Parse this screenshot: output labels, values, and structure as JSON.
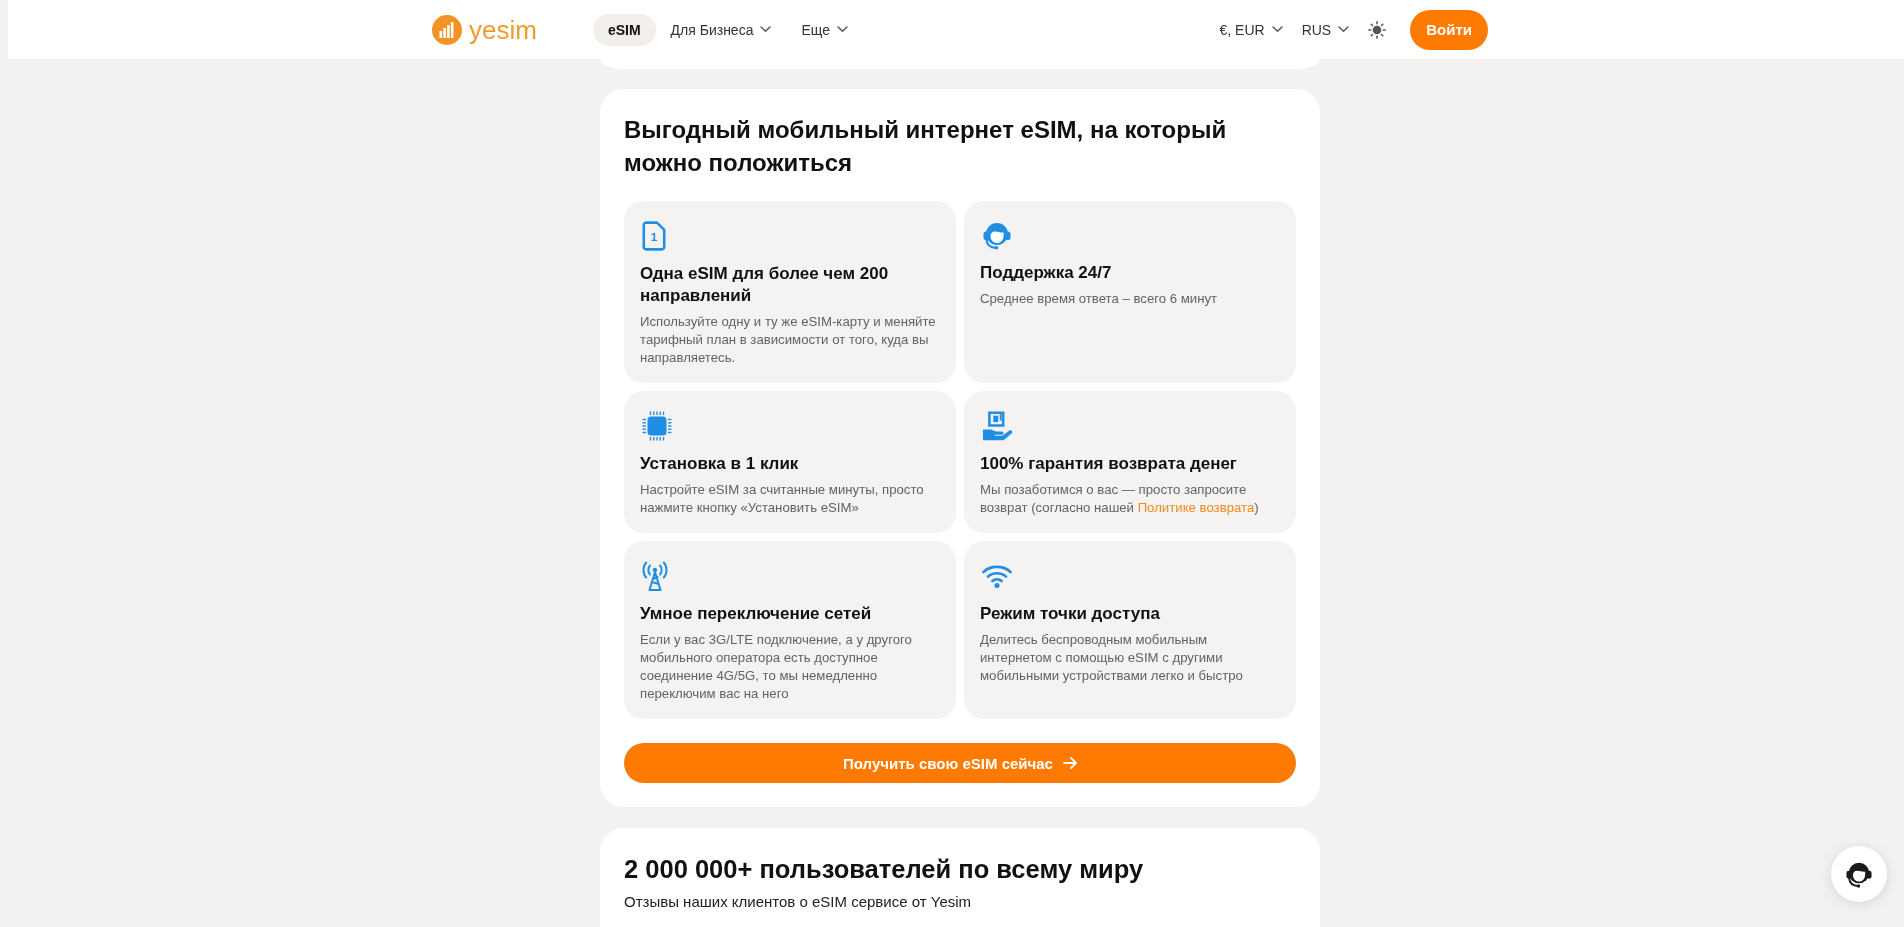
{
  "header": {
    "logo": {
      "text": "yesim"
    },
    "nav": [
      {
        "label": "eSIM",
        "selected": true,
        "dropdown": false
      },
      {
        "label": "Для Бизнеса",
        "selected": false,
        "dropdown": true
      },
      {
        "label": "Еще",
        "selected": false,
        "dropdown": true
      }
    ],
    "selectors": [
      {
        "label": "€, EUR"
      },
      {
        "label": "RUS"
      }
    ],
    "login_button": "Войти"
  },
  "features_section": {
    "title": "Выгодный мобильный интернет eSIM, на который можно положиться",
    "features": [
      {
        "kind": "coverage",
        "icon_label": "1",
        "title": "Одна eSIM для более чем 200 направлений",
        "description": "Используйте одну и ту же eSIM-карту и меняйте тарифный план в зависимости от того, куда вы направляетесь."
      },
      {
        "kind": "support",
        "title": "Поддержка 24/7",
        "description": "Среднее время ответа – всего 6 минут"
      },
      {
        "kind": "install",
        "title": "Установка в 1 клик",
        "description": "Настройте eSIM за считанные минуты, просто нажмите кнопку «Установить eSIM»"
      },
      {
        "kind": "refund",
        "title": "100% гарантия возврата денег",
        "description": "Мы позаботимся о вас — просто запросите возврат (согласно нашей ",
        "link": "Политике возврата",
        "description_end": ")"
      },
      {
        "kind": "switching",
        "title": "Умное переключение сетей",
        "description": "Если у вас 3G/LTE подключение, а у другого мобильного оператора есть доступное соединение 4G/5G, то мы немедленно переключим вас на него"
      },
      {
        "kind": "hotspot",
        "title": "Режим точки доступа",
        "description": "Делитесь беспроводным мобильным интернетом с помощью eSIM с другими мобильными устройствами легко и быстро"
      }
    ],
    "cta_button": "Получить свою eSIM сейчас"
  },
  "reviews_section": {
    "title": "2 000 000+ пользователей по всему миру",
    "subtitle": "Отзывы наших клиентов о eSIM сервисе от Yesim"
  }
}
